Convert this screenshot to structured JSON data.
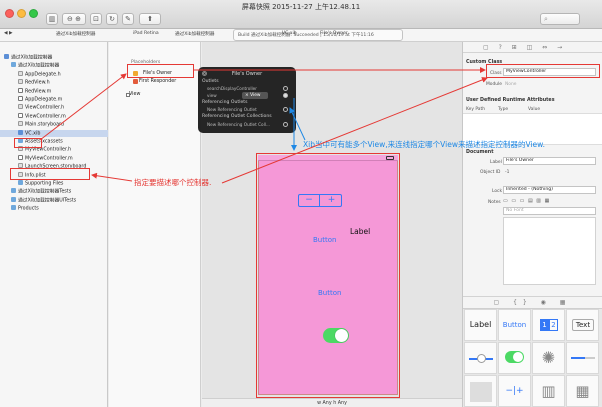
{
  "window": {
    "title": "屏幕快照 2015-11-27 上午12.48.11"
  },
  "jumpbar": {
    "crumbs": [
      "通过Xib加载控制器",
      "iPad Retina",
      "通过Xib加载控制器",
      "VC.xib",
      "File's Owner"
    ],
    "build_status": "Build 通过Xib加载控制器: Succeeded | 15/10/19 at 下午11:16"
  },
  "navigator": {
    "items": [
      {
        "label": "通过Xib加载控制器",
        "icon": "project-icon",
        "indent": 0
      },
      {
        "label": "通过Xib加载控制器",
        "icon": "folder-icon",
        "indent": 1
      },
      {
        "label": "AppDelegate.h",
        "icon": "header-file-icon",
        "indent": 2
      },
      {
        "label": "RedView.h",
        "icon": "header-file-icon",
        "indent": 2
      },
      {
        "label": "RedView.m",
        "icon": "impl-file-icon",
        "indent": 2
      },
      {
        "label": "AppDelegate.m",
        "icon": "impl-file-icon",
        "indent": 2
      },
      {
        "label": "ViewController.h",
        "icon": "header-file-icon",
        "indent": 2
      },
      {
        "label": "ViewController.m",
        "icon": "impl-file-icon",
        "indent": 2
      },
      {
        "label": "Main.storyboard",
        "icon": "storyboard-icon",
        "indent": 2
      },
      {
        "label": "VC.xib",
        "icon": "xib-file-icon",
        "indent": 2
      },
      {
        "label": "Assets.xcassets",
        "icon": "assets-icon",
        "indent": 2
      },
      {
        "label": "MyViewController.h",
        "icon": "header-file-icon",
        "indent": 2
      },
      {
        "label": "MyViewController.m",
        "icon": "impl-file-icon",
        "indent": 2
      },
      {
        "label": "LaunchScreen.storyboard",
        "icon": "storyboard-icon",
        "indent": 2
      },
      {
        "label": "Info.plist",
        "icon": "plist-icon",
        "indent": 2
      },
      {
        "label": "Supporting Files",
        "icon": "folder-icon",
        "indent": 2
      },
      {
        "label": "通过Xib加载控制器Tests",
        "icon": "folder-icon",
        "indent": 1
      },
      {
        "label": "通过Xib加载控制器UITests",
        "icon": "folder-icon",
        "indent": 1
      },
      {
        "label": "Products",
        "icon": "folder-icon",
        "indent": 1
      }
    ]
  },
  "outline": {
    "placeholders_label": "Placeholders",
    "files_owner": "File's Owner",
    "first_responder": "First Responder",
    "view": "View"
  },
  "popup": {
    "title": "File's Owner",
    "outlets_label": "Outlets",
    "outlet1": "searchDisplayController",
    "outlet2": "view",
    "outlet2_target": "View",
    "ref_outlets_label": "Referencing Outlets",
    "new_ref_outlet": "New Referencing Outlet",
    "ref_collections_label": "Referencing Outlet Collections",
    "new_ref_collection": "New Referencing Outlet Coll..."
  },
  "canvas": {
    "stepper_minus": "−",
    "stepper_plus": "+",
    "label": "Label",
    "button1": "Button",
    "button2": "Button",
    "size_class": "w Any  h Any"
  },
  "inspector": {
    "custom_class_header": "Custom Class",
    "class_label": "Class",
    "class_value": "MyViewController",
    "module_label": "Module",
    "module_placeholder": "None",
    "udra_header": "User Defined Runtime Attributes",
    "col_keypath": "Key Path",
    "col_type": "Type",
    "col_value": "Value",
    "document_header": "Document",
    "doc_label_label": "Label",
    "doc_label_value": "File's Owner",
    "object_id_label": "Object ID",
    "object_id_value": "-1",
    "lock_label": "Lock",
    "lock_value": "Inherited - (Nothing)",
    "notes_label": "Notes",
    "font_placeholder": "No Font"
  },
  "library": {
    "label": "Label",
    "button": "Button",
    "seg1": "1",
    "seg2": "2",
    "text": "Text"
  },
  "annotations": {
    "blue_note": "Xib当中可有能多个View,来连线指定哪个View来描述指定控制器的View.",
    "red_note": "指定要描述哪个控制器."
  },
  "colors": {
    "annotation_red": "#e53935",
    "annotation_blue": "#1e88e5",
    "view_background": "#f598d7",
    "switch_on": "#4cd964",
    "ios_blue": "#3478f6"
  }
}
